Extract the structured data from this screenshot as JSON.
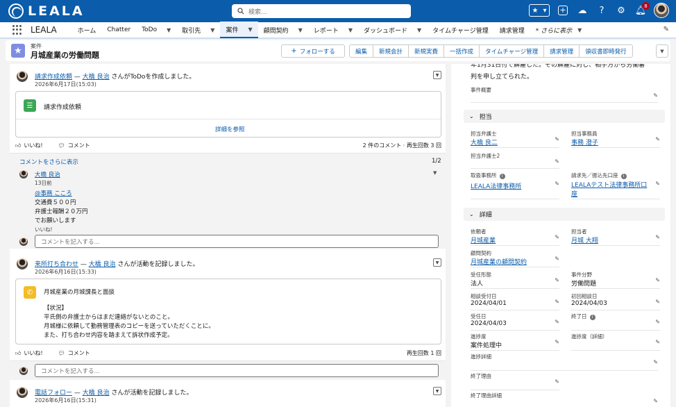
{
  "header": {
    "brand": "LEALA",
    "search_placeholder": "検索...",
    "notification_count": "8"
  },
  "nav": {
    "app_name": "LEALA",
    "items": [
      {
        "label": "ホーム",
        "caret": false
      },
      {
        "label": "Chatter",
        "caret": false
      },
      {
        "label": "ToDo",
        "caret": true
      },
      {
        "label": "取引先",
        "caret": true
      },
      {
        "label": "案件",
        "caret": true
      },
      {
        "label": "顧問契約",
        "caret": true
      },
      {
        "label": "レポート",
        "caret": true
      },
      {
        "label": "ダッシュボード",
        "caret": true
      },
      {
        "label": "タイムチャージ管理",
        "caret": false
      },
      {
        "label": "請求管理",
        "caret": false
      },
      {
        "label": "* さらに表示",
        "caret": true
      }
    ]
  },
  "record": {
    "object_type": "案件",
    "title": "月城産業の労働問題",
    "follow_label": "フォローする",
    "actions": [
      "編集",
      "新規会計",
      "新規実費",
      "一括作成",
      "タイムチャージ管理",
      "請求管理",
      "領収書即時発行"
    ]
  },
  "feed": {
    "post1": {
      "subject": "請求作成依頼",
      "sep": " — ",
      "author": "大橋 良治",
      "verb": " さんがToDoを作成しました。",
      "time": "2026年6月17日(15:03)",
      "card_text": "請求作成依頼",
      "detail_link": "詳細を参照",
      "like": "いいね!",
      "comment": "コメント",
      "stats": "2 件のコメント · 再生回数 3 回",
      "more_comments": "コメントをさらに表示",
      "page": "1/2",
      "comment_author": "大橋 良治",
      "comment_ago": "13日前",
      "comment_mention": "@事務 こころ",
      "comment_lines": [
        "交通費５００円",
        "弁護士報酬２０万円",
        "でお願いします"
      ],
      "comment_like": "いいね!",
      "input_placeholder": "コメントを記入する..."
    },
    "post2": {
      "subject": "来所打ち合わせ",
      "sep": " — ",
      "author": "大橋 良治",
      "verb": " さんが活動を記録しました。",
      "time": "2026年6月16日(15:33)",
      "card_title": "月城産業の月城課長と面談",
      "card_lines": [
        "【状況】",
        "平氏側の弁護士からはまだ連絡がないとのこと。",
        "月城様に依頼して勤務管理表のコピーを送っていただくことに。",
        "また、打ち合わせ内容を踏まえて訴状作成予定。"
      ],
      "like": "いいね!",
      "comment": "コメント",
      "stats": "再生回数 1 回",
      "input_placeholder": "コメントを記入する..."
    },
    "post3": {
      "subject": "電話フォロー",
      "sep": " — ",
      "author": "大橋 良治",
      "verb": " さんが活動を記録しました。",
      "time": "2026年6月16日(15:31)"
    }
  },
  "details": {
    "overview_lines": [
      "年1月31日付で解雇した。その解雇に対し、相手方から労働審",
      "判を申し立てられた。"
    ],
    "overview_label": "事件概要",
    "section_tantou": "担当",
    "section_shosai": "詳細",
    "fields": {
      "lawyer": {
        "label": "担当弁護士",
        "value": "大橋 良二"
      },
      "clerk": {
        "label": "担当事務員",
        "value": "事務 澄子"
      },
      "lawyer2": {
        "label": "担当弁護士2",
        "value": ""
      },
      "office": {
        "label": "取扱事務所",
        "value": "LEALA法律事務所"
      },
      "billing": {
        "label": "請求先／振込先口座",
        "value": "LEALAテスト法律事務所口座"
      },
      "client": {
        "label": "依頼者",
        "value": "月城産業"
      },
      "person": {
        "label": "担当者",
        "value": "月城 大翔"
      },
      "contract": {
        "label": "顧問契約",
        "value": "月城産業の顧問契約"
      },
      "form": {
        "label": "受任形態",
        "value": "法人"
      },
      "field": {
        "label": "事件分野",
        "value": "労働問題"
      },
      "consult": {
        "label": "相談受付日",
        "value": "2024/04/01"
      },
      "first_consult": {
        "label": "初回相談日",
        "value": "2024/04/03"
      },
      "accepted": {
        "label": "受任日",
        "value": "2024/04/03"
      },
      "end": {
        "label": "終了日",
        "value": ""
      },
      "progress": {
        "label": "進捗度",
        "value": "案件処理中"
      },
      "progress_detail": {
        "label": "進捗度（詳細）",
        "value": ""
      },
      "progress_note": {
        "label": "進捗詳細",
        "value": ""
      },
      "end_reason": {
        "label": "終了理由",
        "value": ""
      },
      "end_reason_detail": {
        "label": "終了理由詳細",
        "value": ""
      }
    }
  }
}
